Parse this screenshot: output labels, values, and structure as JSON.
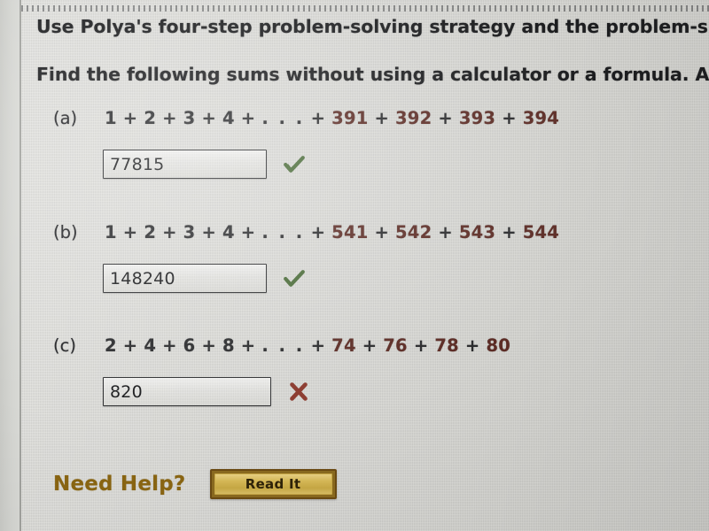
{
  "page": {
    "background_color": "#dcdcd8",
    "text_color": "#1c1d1f",
    "accent_color": "#5c2c25",
    "help_color": "#8a6512"
  },
  "instructions": {
    "line1": "Use Polya's four-step problem-solving strategy and the problem-s",
    "line2": "Find the following sums without using a calculator or a formula. A"
  },
  "parts": [
    {
      "label": "(a)",
      "expression": {
        "small_terms": [
          "1",
          "2",
          "3",
          "4"
        ],
        "ellipsis": ". . .",
        "big_terms": [
          "391",
          "392",
          "393",
          "394"
        ],
        "full_text": "1 + 2 + 3 + 4 + . . . + 391 + 392 + 393 + 394"
      },
      "answer_value": "77815",
      "status": "correct",
      "status_icon": "green-check-icon",
      "status_color": "#4a6b38"
    },
    {
      "label": "(b)",
      "expression": {
        "small_terms": [
          "1",
          "2",
          "3",
          "4"
        ],
        "ellipsis": ". . .",
        "big_terms": [
          "541",
          "542",
          "543",
          "544"
        ],
        "full_text": "1 + 2 + 3 + 4 + . . . + 541 + 542 + 543 + 544"
      },
      "answer_value": "148240",
      "status": "correct",
      "status_icon": "green-check-icon",
      "status_color": "#4a6b38"
    },
    {
      "label": "(c)",
      "expression": {
        "small_terms": [
          "2",
          "4",
          "6",
          "8"
        ],
        "ellipsis": ". . .",
        "big_terms": [
          "74",
          "76",
          "78",
          "80"
        ],
        "full_text": "2 + 4 + 6 + 8 + . . . + 74 + 76 + 78 + 80"
      },
      "answer_value": "820",
      "status": "incorrect",
      "status_icon": "red-cross-icon",
      "status_color": "#8b3a2e"
    }
  ],
  "help": {
    "label": "Need Help?",
    "button_label": "Read It"
  },
  "operator": "+"
}
